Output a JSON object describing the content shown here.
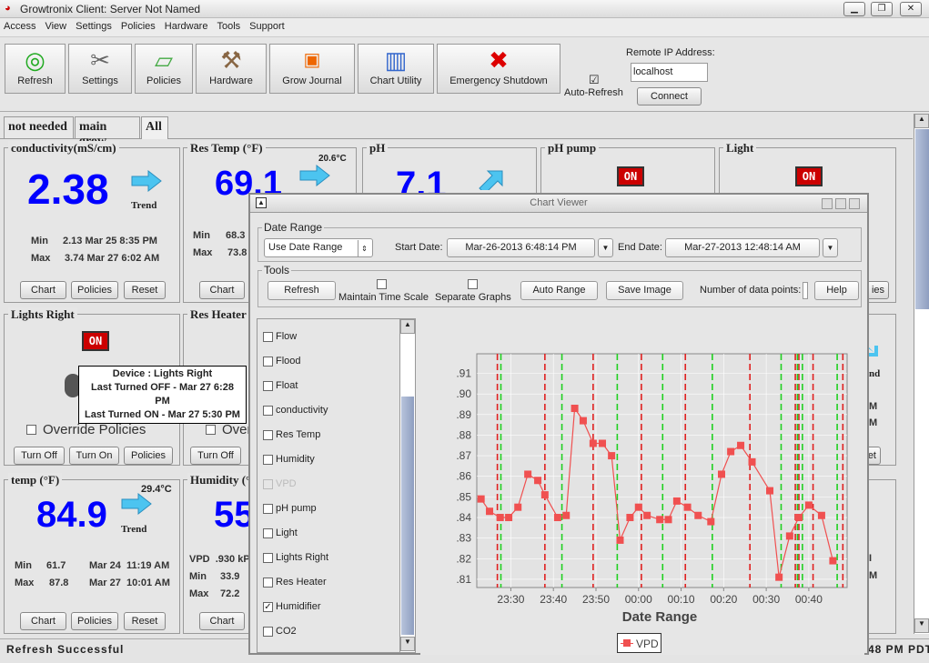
{
  "window": {
    "title": "Growtronix Client: Server Not Named",
    "controls": [
      "minimize",
      "restore",
      "close"
    ]
  },
  "menu": [
    "Access",
    "View",
    "Settings",
    "Policies",
    "Hardware",
    "Tools",
    "Support"
  ],
  "toolbar": {
    "buttons": [
      {
        "label": "Refresh",
        "icon": "refresh-icon"
      },
      {
        "label": "Settings",
        "icon": "tools-icon"
      },
      {
        "label": "Policies",
        "icon": "book-icon"
      },
      {
        "label": "Hardware",
        "icon": "hammer-icon"
      },
      {
        "label": "Grow Journal",
        "icon": "calendar-icon"
      },
      {
        "label": "Chart Utility",
        "icon": "chart-icon"
      },
      {
        "label": "Emergency Shutdown",
        "icon": "red-x-icon"
      }
    ],
    "auto_refresh": {
      "label": "Auto-Refresh",
      "checked": true
    },
    "remote_ip_label": "Remote IP Address:",
    "remote_ip_value": "localhost",
    "connect_label": "Connect"
  },
  "tabs": [
    {
      "label": "not needed"
    },
    {
      "label": "main grow"
    },
    {
      "label": "All",
      "active": true
    }
  ],
  "panels": {
    "conductivity": {
      "title": "conductivity(mS/cm)",
      "value": "2.38",
      "trend": "Trend",
      "min_label": "Min",
      "min": "2.13 Mar 25 8:35 PM",
      "max_label": "Max",
      "max": "3.74 Mar 27 6:02 AM",
      "buttons": [
        "Chart",
        "Policies",
        "Reset"
      ]
    },
    "res_temp": {
      "title": "Res Temp (°F)",
      "value": "69.1",
      "alt": "20.6°C",
      "min_label": "Min",
      "min": "68.3",
      "max_label": "Max",
      "max": "73.8",
      "button": "Chart"
    },
    "ph": {
      "title": "pH",
      "value": "7.1"
    },
    "ph_pump": {
      "title": "pH pump",
      "state": "ON"
    },
    "light": {
      "title": "Light",
      "state": "ON",
      "button_fragment": "ies"
    },
    "lights_right": {
      "title": "Lights Right",
      "state": "ON",
      "tooltip": [
        "Device : Lights Right",
        "Last Turned OFF - Mar 27 6:28 PM",
        "Last Turned ON - Mar 27 5:30 PM"
      ],
      "override": "Override Policies",
      "buttons": [
        "Turn Off",
        "Turn On",
        "Policies"
      ]
    },
    "res_heater": {
      "title": "Res Heater",
      "override": "Over",
      "button": "Turn Off"
    },
    "right_mid": {
      "trend_fragment": "nd",
      "min_fragment": "M",
      "max_fragment": "M",
      "button_fragment": "et"
    },
    "right_bottom": {
      "min_fragment": "I",
      "max_fragment": "M"
    },
    "temp": {
      "title": "temp (°F)",
      "value": "84.9",
      "alt": "29.4°C",
      "trend": "Trend",
      "min_label": "Min",
      "min_val": "61.7",
      "min_date": "Mar 24  11:19 AM",
      "max_label": "Max",
      "max_val": "87.8",
      "max_date": "Mar 27  10:01 AM",
      "buttons": [
        "Chart",
        "Policies",
        "Reset"
      ]
    },
    "humidity": {
      "title": "Humidity (°",
      "value": "55",
      "vpd": "VPD  .930 kP",
      "min_label": "Min",
      "min": "33.9",
      "max_label": "Max",
      "max": "72.2",
      "button": "Chart"
    }
  },
  "status": {
    "message": "Refresh Successful",
    "time_fragment": "48 PM PDT"
  },
  "chart_viewer": {
    "title": "Chart Viewer",
    "date_range": {
      "group": "Date Range",
      "mode": "Use Date Range",
      "start_label": "Start Date:",
      "start": "Mar-26-2013 6:48:14 PM",
      "end_label": "End Date:",
      "end": "Mar-27-2013 12:48:14 AM"
    },
    "tools": {
      "group": "Tools",
      "refresh": "Refresh",
      "maintain_time_scale": {
        "label": "Maintain Time Scale",
        "checked": false
      },
      "separate_graphs": {
        "label": "Separate Graphs",
        "checked": false
      },
      "auto_range": "Auto Range",
      "save_image": "Save Image",
      "data_points_label": "Number of data points:",
      "data_points_value": "",
      "help": "Help"
    },
    "series_list": [
      {
        "label": "Flow",
        "checked": false
      },
      {
        "label": "Flood",
        "checked": false
      },
      {
        "label": "Float",
        "checked": false
      },
      {
        "label": "conductivity",
        "checked": false
      },
      {
        "label": "Res Temp",
        "checked": false
      },
      {
        "label": "Humidity",
        "checked": false
      },
      {
        "label": "VPD",
        "checked": false,
        "disabled": true
      },
      {
        "label": "pH pump",
        "checked": false
      },
      {
        "label": "Light",
        "checked": false
      },
      {
        "label": "Lights Right",
        "checked": false
      },
      {
        "label": "Res Heater",
        "checked": false
      },
      {
        "label": "Humidifier",
        "checked": true
      },
      {
        "label": "CO2",
        "checked": false
      }
    ]
  },
  "chart_data": {
    "type": "line",
    "xlabel": "Date Range",
    "ylabel": "",
    "xlim": [
      "23:22",
      "00:49"
    ],
    "ylim": [
      0.806,
      0.9195
    ],
    "x_ticks": [
      "23:30",
      "23:40",
      "23:50",
      "00:00",
      "00:10",
      "00:20",
      "00:30",
      "00:40"
    ],
    "y_ticks": [
      ".81",
      ".82",
      ".83",
      ".84",
      ".85",
      ".86",
      ".87",
      ".88",
      ".89",
      ".90",
      ".91"
    ],
    "grid": true,
    "legend": "bottom",
    "series": [
      {
        "name": "VPD",
        "color": "#f05050",
        "marker": "square",
        "x": [
          "23:23",
          "23:25",
          "23:27:30",
          "23:29:30",
          "23:31:40",
          "23:34",
          "23:36:20",
          "23:38",
          "23:41",
          "23:43",
          "23:45",
          "23:47",
          "23:49:20",
          "23:51:30",
          "23:53:40",
          "23:55:40",
          "23:58",
          "00:00",
          "00:02",
          "00:05",
          "00:07",
          "00:09",
          "00:11:30",
          "00:14",
          "00:17",
          "00:19:30",
          "00:21:40",
          "00:24",
          "00:26:40",
          "00:30:50",
          "00:33",
          "00:35:30",
          "00:37:40",
          "00:40",
          "00:43",
          "00:45:40"
        ],
        "y": [
          0.849,
          0.843,
          0.84,
          0.84,
          0.845,
          0.861,
          0.858,
          0.851,
          0.84,
          0.841,
          0.893,
          0.887,
          0.876,
          0.876,
          0.87,
          0.829,
          0.84,
          0.845,
          0.841,
          0.839,
          0.839,
          0.848,
          0.845,
          0.841,
          0.838,
          0.861,
          0.872,
          0.875,
          0.867,
          0.853,
          0.811,
          0.831,
          0.84,
          0.846,
          0.841,
          0.819
        ]
      }
    ],
    "event_lines_red": {
      "color": "#e02020",
      "x": [
        "23:26:50",
        "23:38",
        "23:49:20",
        "00:00:40",
        "00:11",
        "00:26:10",
        "00:36:50",
        "00:37:40",
        "00:41",
        "00:48"
      ]
    },
    "event_lines_green": {
      "color": "#20d020",
      "x": [
        "23:27:40",
        "23:42",
        "23:55",
        "00:05:40",
        "00:17:20",
        "00:33:30",
        "00:37:20",
        "00:38:30",
        "00:46:40"
      ]
    }
  }
}
